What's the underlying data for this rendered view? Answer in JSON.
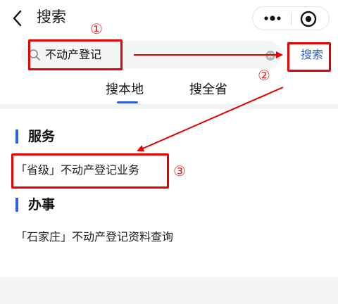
{
  "header": {
    "back_icon": "chevron-left-icon",
    "title": "搜索",
    "capsule": {
      "more_icon": "more-dots-icon",
      "target_icon": "target-icon"
    }
  },
  "search": {
    "icon": "search-icon",
    "value": "不动产登记",
    "clear_icon": "clear-icon",
    "button_label": "搜索"
  },
  "tabs": [
    {
      "label": "搜本地",
      "active": true
    },
    {
      "label": "搜全省",
      "active": false
    }
  ],
  "sections": [
    {
      "title": "服务",
      "items": [
        "「省级」不动产登记业务"
      ]
    },
    {
      "title": "办事",
      "items": [
        "「石家庄」不动产登记资料查询"
      ]
    }
  ],
  "annotations": {
    "markers": [
      "①",
      "②",
      "③"
    ],
    "color": "#e60000"
  },
  "colors": {
    "accent": "#2a5bd7",
    "section_bar": "#2f63dc",
    "annotation": "#e60000"
  }
}
